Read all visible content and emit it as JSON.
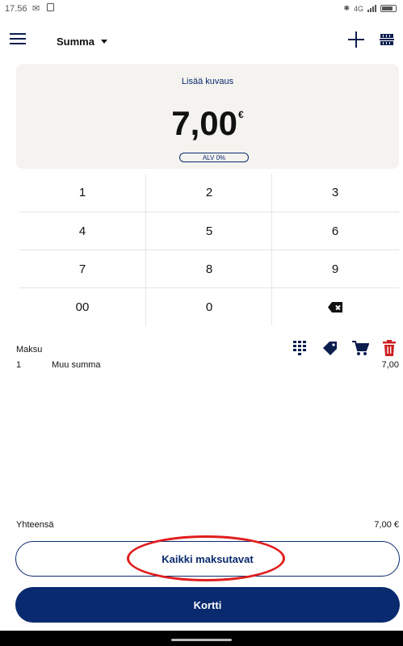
{
  "status_bar": {
    "time": "17.56",
    "network": "4G",
    "mail_icon": "mail-icon",
    "battery_icon": "battery-icon"
  },
  "app_bar": {
    "title": "Summa",
    "menu_icon": "menu-icon",
    "add_icon": "plus-icon",
    "scan_icon": "barcode-scanner-icon"
  },
  "amount_card": {
    "description_link": "Lisää kuvaus",
    "amount": "7,00",
    "currency": "€",
    "vat_chip": "ALV 0%"
  },
  "keypad": {
    "keys": [
      "1",
      "2",
      "3",
      "4",
      "5",
      "6",
      "7",
      "8",
      "9",
      "00",
      "0"
    ],
    "backspace_icon": "backspace-icon"
  },
  "payment": {
    "section_label": "Maksu",
    "tool_icons": [
      "keypad-icon",
      "tag-icon",
      "cart-icon",
      "trash-icon"
    ],
    "items": [
      {
        "qty": "1",
        "name": "Muu summa",
        "price": "7,00"
      }
    ],
    "total_label": "Yhteensä",
    "total_value": "7,00 €"
  },
  "buttons": {
    "all_methods": "Kaikki maksutavat",
    "card": "Kortti"
  },
  "colors": {
    "primary": "#0a2a70",
    "card_bg": "#f5f3ef",
    "highlight": "#e01e1e",
    "trash": "#cc1f1f"
  }
}
